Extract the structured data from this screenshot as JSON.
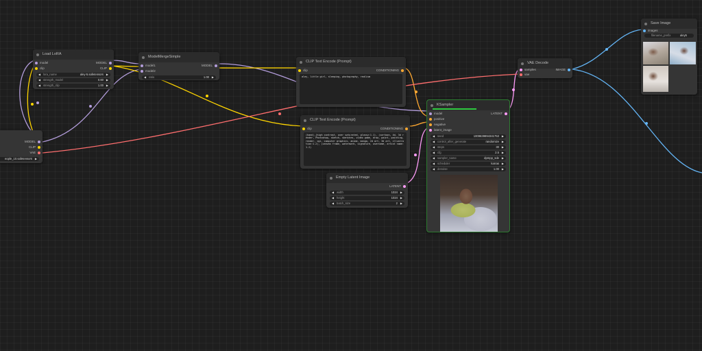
{
  "nodes": {
    "load_lora": {
      "title": "Load LoRA",
      "inputs": [
        "model",
        "clip"
      ],
      "outputs": [
        "MODEL",
        "CLIP"
      ],
      "widgets": [
        {
          "label": "lora_name",
          "value": "aley-5.safetensors"
        },
        {
          "label": "strength_model",
          "value": "0.60"
        },
        {
          "label": "strength_clip",
          "value": "1.00"
        }
      ]
    },
    "model_merge": {
      "title": "ModelMergeSimple",
      "inputs": [
        "model1",
        "model2"
      ],
      "outputs": [
        "MODEL"
      ],
      "widgets": [
        {
          "label": "ratio",
          "value": "1.00"
        }
      ]
    },
    "checkpoint": {
      "outputs": [
        "MODEL",
        "CLIP",
        "VAE"
      ],
      "widget_value": "eople_10.safetensors"
    },
    "clip_pos": {
      "title": "CLIP Text Encode (Prompt)",
      "input": "clip",
      "output": "CONDITIONING",
      "text": "aley, little girl, sleeping, photography, realism"
    },
    "clip_neg": {
      "title": "CLIP Text Encode (Prompt)",
      "input": "clip",
      "output": "CONDITIONING",
      "text": "(hand),(high contrast, over saturated, glossy:1.1), (cartoon, 4d, 3d render, Photoshop, sketch, sketches, video game, draw, paint, painting, render, cgi, computer graphics, anime, manga, 2d art, 3d art, illustration:1.2), (canvas frame, watermark, signature, username, artist name:1.2)"
    },
    "empty_latent": {
      "title": "Empty Latent Image",
      "output": "LATENT",
      "widgets": [
        {
          "label": "width",
          "value": "1024"
        },
        {
          "label": "height",
          "value": "1024"
        },
        {
          "label": "batch_size",
          "value": "2"
        }
      ]
    },
    "ksampler": {
      "title": "KSampler",
      "inputs": [
        "model",
        "positive",
        "negative",
        "latent_image"
      ],
      "output": "LATENT",
      "widgets": [
        {
          "label": "seed",
          "value": "1009639894341753"
        },
        {
          "label": "control_after_generate",
          "value": "randomize"
        },
        {
          "label": "steps",
          "value": "30"
        },
        {
          "label": "cfg",
          "value": "2.5"
        },
        {
          "label": "sampler_name",
          "value": "dpmpp_sde"
        },
        {
          "label": "scheduler",
          "value": "karras"
        },
        {
          "label": "denoise",
          "value": "1.00"
        }
      ]
    },
    "vae_decode": {
      "title": "VAE Decode",
      "inputs": [
        "samples",
        "vae"
      ],
      "output": "IMAGE"
    },
    "save_image": {
      "title": "Save Image",
      "input": "images",
      "widgets": [
        {
          "label": "filename_prefix",
          "value": "aley5"
        }
      ]
    }
  },
  "colors": {
    "model": "#b39ddb",
    "clip": "#ffd500",
    "conditioning": "#ffa931",
    "latent": "#ff9cf9",
    "vae": "#ff6e6e",
    "image": "#64b5f6"
  }
}
